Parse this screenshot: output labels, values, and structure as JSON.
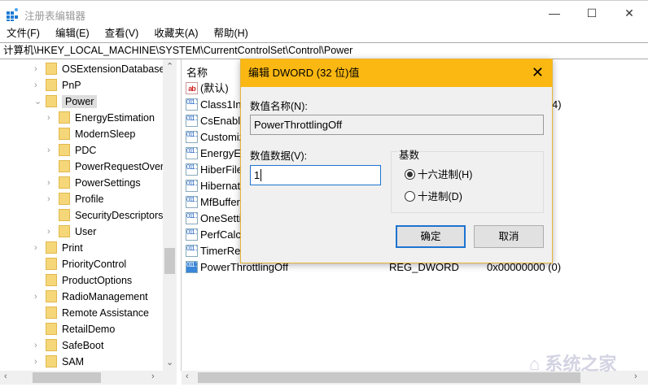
{
  "window": {
    "title": "注册表编辑器",
    "minimize": "—",
    "maximize": "☐",
    "close": "✕"
  },
  "menu": [
    "文件(F)",
    "编辑(E)",
    "查看(V)",
    "收藏夹(A)",
    "帮助(H)"
  ],
  "address": "计算机\\HKEY_LOCAL_MACHINE\\SYSTEM\\CurrentControlSet\\Control\\Power",
  "tree": [
    {
      "label": "OSExtensionDatabase",
      "level": 1,
      "expander": "›"
    },
    {
      "label": "PnP",
      "level": 1,
      "expander": "›"
    },
    {
      "label": "Power",
      "level": 1,
      "expander": "⌄",
      "selected": true
    },
    {
      "label": "EnergyEstimation",
      "level": 2,
      "expander": "›"
    },
    {
      "label": "ModernSleep",
      "level": 2,
      "expander": ""
    },
    {
      "label": "PDC",
      "level": 2,
      "expander": "›"
    },
    {
      "label": "PowerRequestOverride",
      "level": 2,
      "expander": ""
    },
    {
      "label": "PowerSettings",
      "level": 2,
      "expander": "›"
    },
    {
      "label": "Profile",
      "level": 2,
      "expander": "›"
    },
    {
      "label": "SecurityDescriptors",
      "level": 2,
      "expander": ""
    },
    {
      "label": "User",
      "level": 2,
      "expander": "›"
    },
    {
      "label": "Print",
      "level": 1,
      "expander": "›"
    },
    {
      "label": "PriorityControl",
      "level": 1,
      "expander": ""
    },
    {
      "label": "ProductOptions",
      "level": 1,
      "expander": ""
    },
    {
      "label": "RadioManagement",
      "level": 1,
      "expander": "›"
    },
    {
      "label": "Remote Assistance",
      "level": 1,
      "expander": ""
    },
    {
      "label": "RetailDemo",
      "level": 1,
      "expander": ""
    },
    {
      "label": "SafeBoot",
      "level": 1,
      "expander": "›"
    },
    {
      "label": "SAM",
      "level": 1,
      "expander": "›"
    }
  ],
  "values_pane": {
    "column_name": "名称",
    "rows": [
      {
        "name": "(默认)",
        "icon": "string-value-icon",
        "type": "",
        "data": ""
      },
      {
        "name": "Class1In",
        "icon": "dword-value-icon",
        "type": "",
        "data": "4)"
      },
      {
        "name": "CsEnable",
        "icon": "dword-value-icon",
        "type": "",
        "data": ""
      },
      {
        "name": "Customiz",
        "icon": "dword-value-icon",
        "type": "",
        "data": ""
      },
      {
        "name": "EnergyEs",
        "icon": "dword-value-icon",
        "type": "",
        "data": ""
      },
      {
        "name": "HiberFile",
        "icon": "dword-value-icon",
        "type": "",
        "data": ""
      },
      {
        "name": "Hibernat",
        "icon": "dword-value-icon",
        "type": "",
        "data": ""
      },
      {
        "name": "MfBuffer",
        "icon": "dword-value-icon",
        "type": "",
        "data": ""
      },
      {
        "name": "OneSetti",
        "icon": "dword-value-icon",
        "type": "",
        "data": ""
      },
      {
        "name": "PerfCalc",
        "icon": "dword-value-icon",
        "type": "",
        "data": ""
      },
      {
        "name": "TimerRe",
        "icon": "dword-value-icon",
        "type": "",
        "data": ""
      },
      {
        "name": "PowerThrottlingOff",
        "icon": "dword-value-icon",
        "type": "REG_DWORD",
        "data": "0x00000000 (0)",
        "selected": true
      }
    ]
  },
  "dialog": {
    "title": "编辑 DWORD (32 位)值",
    "close": "✕",
    "name_label": "数值名称(N):",
    "name_value": "PowerThrottlingOff",
    "data_label": "数值数据(V):",
    "data_value": "1",
    "base_label": "基数",
    "radio_hex": "十六进制(H)",
    "radio_dec": "十进制(D)",
    "base_selected": "hex",
    "ok": "确定",
    "cancel": "取消"
  },
  "watermark": "系统之家"
}
